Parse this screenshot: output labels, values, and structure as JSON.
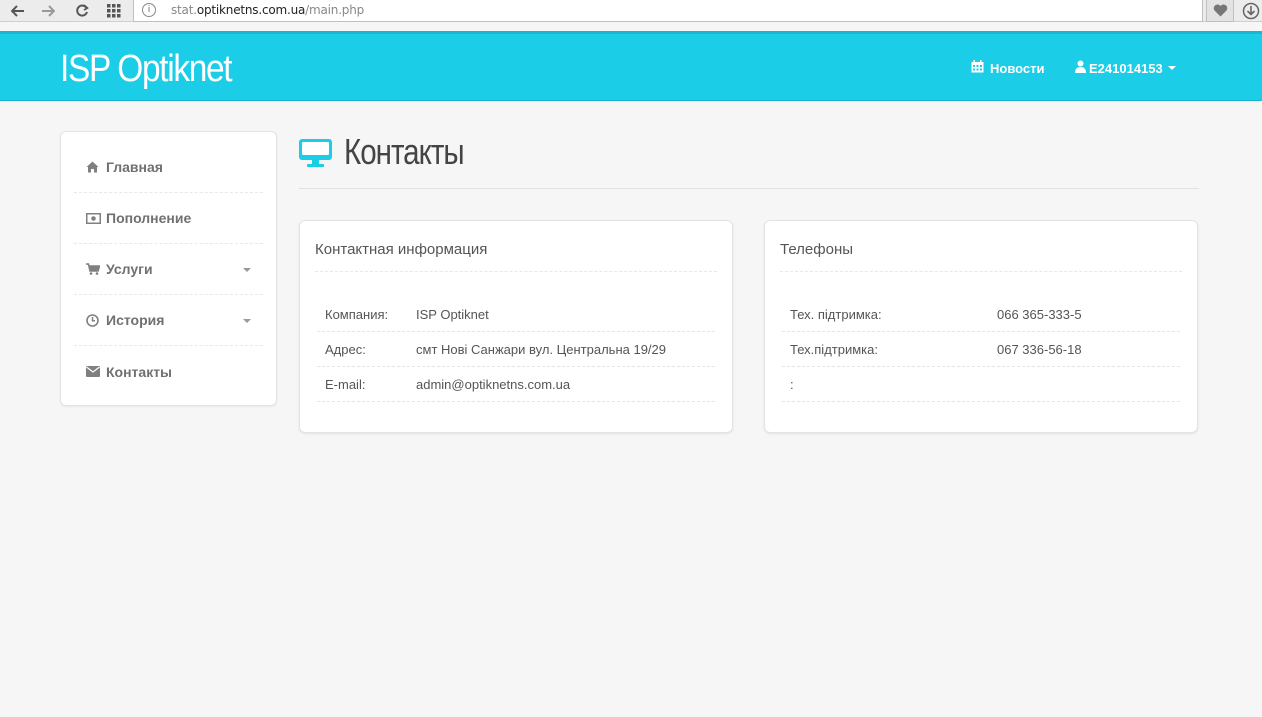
{
  "browser": {
    "url_prefix": "stat.",
    "url_domain": "optiknetns.com.ua",
    "url_path": "/main.php"
  },
  "header": {
    "brand": "ISP Optiknet",
    "news_label": "Новости",
    "user_label": "E241014153"
  },
  "sidebar": {
    "items": [
      {
        "label": "Главная",
        "icon": "home-icon"
      },
      {
        "label": "Пополнение",
        "icon": "money-icon"
      },
      {
        "label": "Услуги",
        "icon": "cart-icon",
        "dropdown": true
      },
      {
        "label": "История",
        "icon": "clock-icon",
        "dropdown": true
      },
      {
        "label": "Контакты",
        "icon": "envelope-icon"
      }
    ]
  },
  "page": {
    "title": "Контакты",
    "title_icon": "monitor-icon"
  },
  "contact_panel": {
    "title": "Контактная информация",
    "rows": [
      {
        "key": "Компания:",
        "value": "ISP Optiknet"
      },
      {
        "key": "Адрес:",
        "value": "смт Нові Санжари вул. Центральна 19/29"
      },
      {
        "key": "E-mail:",
        "value": "admin@optiknetns.com.ua"
      }
    ]
  },
  "phones_panel": {
    "title": "Телефоны",
    "rows": [
      {
        "key": "Тех. підтримка:",
        "value": "066 365-333-5"
      },
      {
        "key": "Тех.підтримка:",
        "value": "067 336-56-18"
      },
      {
        "key": ":",
        "value": ""
      }
    ]
  },
  "colors": {
    "accent": "#1ccde8",
    "background": "#f6f6f6",
    "text": "#555555"
  }
}
